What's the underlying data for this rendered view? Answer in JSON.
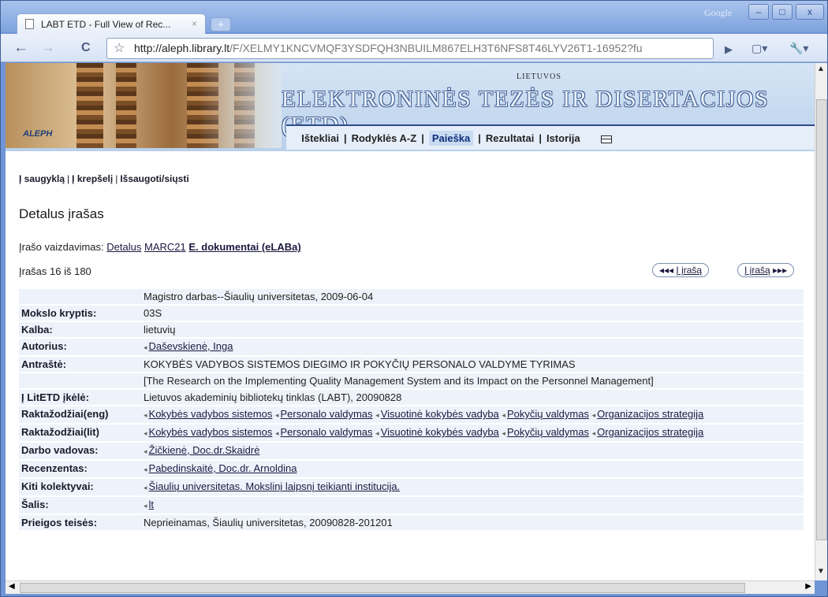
{
  "browser": {
    "tab_title": "LABT ETD - Full View of Rec...",
    "tab_close": "×",
    "new_tab": "+",
    "brand": "Google",
    "url_host": "http://aleph.library.lt",
    "url_path": "/F/XELMY1KNCVMQF3YSDFQH3NBUILM867ELH3T6NFS8T46LYV26T1-16952?fu",
    "back": "←",
    "forward": "→",
    "reload": "C",
    "star": "☆",
    "go": "▶",
    "page_menu": "▢▾",
    "tools_menu": "🔧▾",
    "win_min": "–",
    "win_max": "□",
    "win_close": "x"
  },
  "banner": {
    "aleph": "ALEPH",
    "small": "LIETUVOS",
    "title": "ELEKTRONINĖS TEZĖS IR DISERTACIJOS (ETD)",
    "menu": [
      "Ištekliai",
      "Rodyklės A-Z",
      "Paieška",
      "Rezultatai",
      "Istorija"
    ]
  },
  "actions": [
    "Į saugyklą",
    "Į krepšelį",
    "Išsaugoti/siųsti"
  ],
  "heading": "Detalus įrašas",
  "view": {
    "label": "Įrašo vaizdavimas:",
    "options": [
      "Detalus",
      "MARC21",
      "E. dokumentai (eLABa)"
    ]
  },
  "record_number": "Įrašas 16 iš 180",
  "nav": {
    "prev": "Į įrašą",
    "next": "Į įrašą",
    "prev_arrows": "◂◂◂",
    "next_arrows": "▸▸▸"
  },
  "record": [
    {
      "label": "",
      "value": "Magistro darbas--Šiaulių universitetas, 2009-06-04"
    },
    {
      "label": "Mokslo kryptis:",
      "value": "03S"
    },
    {
      "label": "Kalba:",
      "value": "lietuvių"
    },
    {
      "label": "Autorius:",
      "link": "Daševskienė, Inga"
    },
    {
      "label": "Antraštė:",
      "value": "KOKYBĖS VADYBOS SISTEMOS DIEGIMO IR POKYČIŲ PERSONALO VALDYME TYRIMAS"
    },
    {
      "label": "",
      "value": "[The Research on the Implementing Quality Management System and its Impact on the Personnel Management]"
    },
    {
      "label": "Į LitETD įkėlė:",
      "value": "Lietuvos akademinių bibliotekų tinklas (LABT), 20090828"
    },
    {
      "label": "Raktažodžiai(eng)",
      "kw": [
        "Kokybės vadybos sistemos",
        "Personalo valdymas",
        "Visuotinė kokybės vadyba",
        "Pokyčių valdymas",
        "Organizacijos strategija"
      ]
    },
    {
      "label": "Raktažodžiai(lit)",
      "kw": [
        "Kokybės vadybos sistemos",
        "Personalo valdymas",
        "Visuotinė kokybės vadyba",
        "Pokyčių valdymas",
        "Organizacijos strategija"
      ]
    },
    {
      "label": "Darbo vadovas:",
      "link": "Žičkienė, Doc.dr.Skaidrė"
    },
    {
      "label": "Recenzentas:",
      "link": "Pabedinskaitė, Doc.dr. Arnoldina"
    },
    {
      "label": "Kiti kolektyvai:",
      "link": "Šiaulių universitetas. Mokslinį laipsnį teikianti institucija."
    },
    {
      "label": "Šalis:",
      "link": "lt"
    },
    {
      "label": "Prieigos teisės:",
      "value": "Neprieinamas, Šiaulių universitetas, 20090828-201201"
    }
  ],
  "marker": "◂"
}
